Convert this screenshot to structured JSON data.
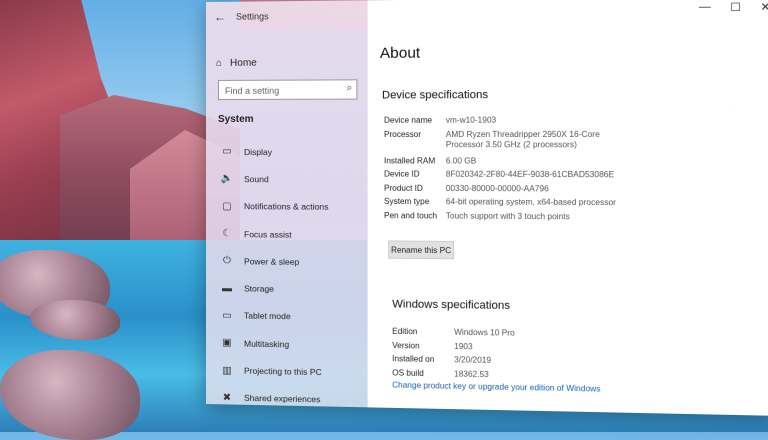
{
  "window": {
    "app_title": "Settings",
    "controls": [
      "—",
      "☐",
      "✕"
    ]
  },
  "nav": {
    "home_label": "Home",
    "search_placeholder": "Find a setting",
    "section_title": "System",
    "items": [
      {
        "label": "Display",
        "icon": "display-icon",
        "glyph": "▭"
      },
      {
        "label": "Sound",
        "icon": "sound-icon",
        "glyph": "🔈"
      },
      {
        "label": "Notifications & actions",
        "icon": "notifications-icon",
        "glyph": "▢"
      },
      {
        "label": "Focus assist",
        "icon": "focus-assist-icon",
        "glyph": "☾"
      },
      {
        "label": "Power & sleep",
        "icon": "power-icon",
        "glyph": "⏻"
      },
      {
        "label": "Storage",
        "icon": "storage-icon",
        "glyph": "▬"
      },
      {
        "label": "Tablet mode",
        "icon": "tablet-mode-icon",
        "glyph": "▭"
      },
      {
        "label": "Multitasking",
        "icon": "multitasking-icon",
        "glyph": "▣"
      },
      {
        "label": "Projecting to this PC",
        "icon": "projecting-icon",
        "glyph": "▥"
      },
      {
        "label": "Shared experiences",
        "icon": "shared-experiences-icon",
        "glyph": "✖"
      }
    ]
  },
  "main": {
    "page_title": "About",
    "device_specs_title": "Device specifications",
    "device_specs": [
      {
        "key": "Device name",
        "value": "vm-w10-1903"
      },
      {
        "key": "Processor",
        "value": "AMD Ryzen Threadripper 2950X 16-Core",
        "value2": "Processor    3.50 GHz  (2 processors)"
      },
      {
        "key": "Installed RAM",
        "value": "6.00 GB"
      },
      {
        "key": "Device ID",
        "value": "8F020342-2F80-44EF-9038-61CBAD53086E"
      },
      {
        "key": "Product ID",
        "value": "00330-80000-00000-AA796"
      },
      {
        "key": "System type",
        "value": "64-bit operating system, x64-based processor"
      },
      {
        "key": "Pen and touch",
        "value": "Touch support with 3 touch points"
      }
    ],
    "rename_button": "Rename this PC",
    "windows_specs_title": "Windows specifications",
    "windows_specs": [
      {
        "key": "Edition",
        "value": "Windows 10 Pro"
      },
      {
        "key": "Version",
        "value": "1903"
      },
      {
        "key": "Installed on",
        "value": "3/20/2019"
      },
      {
        "key": "OS build",
        "value": "18362.53"
      }
    ],
    "change_key_link": "Change product key or upgrade your edition of Windows"
  }
}
